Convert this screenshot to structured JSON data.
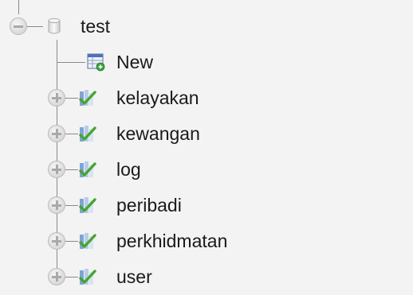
{
  "tree": {
    "database": {
      "label": "test",
      "icon": "database-icon",
      "expanded": true
    },
    "new_item": {
      "label": "New",
      "icon": "new-table-icon"
    },
    "tables": [
      {
        "label": "kelayakan",
        "icon": "table-icon",
        "expanded": false
      },
      {
        "label": "kewangan",
        "icon": "table-icon",
        "expanded": false
      },
      {
        "label": "log",
        "icon": "table-icon",
        "expanded": false
      },
      {
        "label": "peribadi",
        "icon": "table-icon",
        "expanded": false
      },
      {
        "label": "perkhidmatan",
        "icon": "table-icon",
        "expanded": false
      },
      {
        "label": "user",
        "icon": "table-icon",
        "expanded": false
      }
    ]
  }
}
